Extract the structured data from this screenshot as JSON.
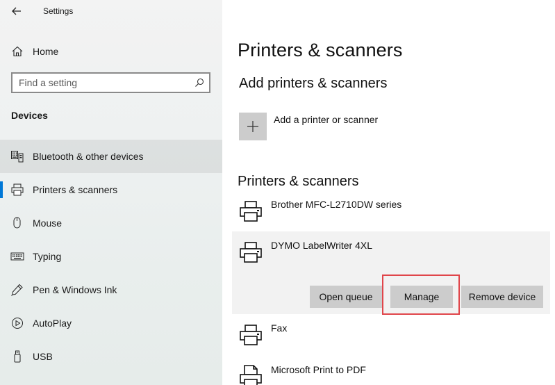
{
  "window": {
    "title": "Settings"
  },
  "sidebar": {
    "home_label": "Home",
    "search_placeholder": "Find a setting",
    "section_title": "Devices",
    "items": [
      {
        "label": "Bluetooth & other devices",
        "icon": "bluetooth-keyboard-icon"
      },
      {
        "label": "Printers & scanners",
        "icon": "printer-icon",
        "selected": true
      },
      {
        "label": "Mouse",
        "icon": "mouse-icon"
      },
      {
        "label": "Typing",
        "icon": "keyboard-icon"
      },
      {
        "label": "Pen & Windows Ink",
        "icon": "pen-icon"
      },
      {
        "label": "AutoPlay",
        "icon": "autoplay-icon"
      },
      {
        "label": "USB",
        "icon": "usb-icon"
      }
    ]
  },
  "main": {
    "title": "Printers & scanners",
    "add_section_title": "Add printers & scanners",
    "add_label": "Add a printer or scanner",
    "list_title": "Printers & scanners",
    "devices": [
      {
        "name": "Brother MFC-L2710DW series",
        "icon": "printer-icon"
      },
      {
        "name": "DYMO LabelWriter 4XL",
        "icon": "printer-icon",
        "expanded": true
      },
      {
        "name": "Fax",
        "icon": "fax-icon"
      },
      {
        "name": "Microsoft Print to PDF",
        "icon": "pdf-printer-icon"
      }
    ],
    "actions": {
      "open_queue": "Open queue",
      "manage": "Manage",
      "remove_device": "Remove device"
    }
  },
  "colors": {
    "accent": "#0078d7",
    "button": "#cccccc",
    "highlight": "#e0454a"
  }
}
